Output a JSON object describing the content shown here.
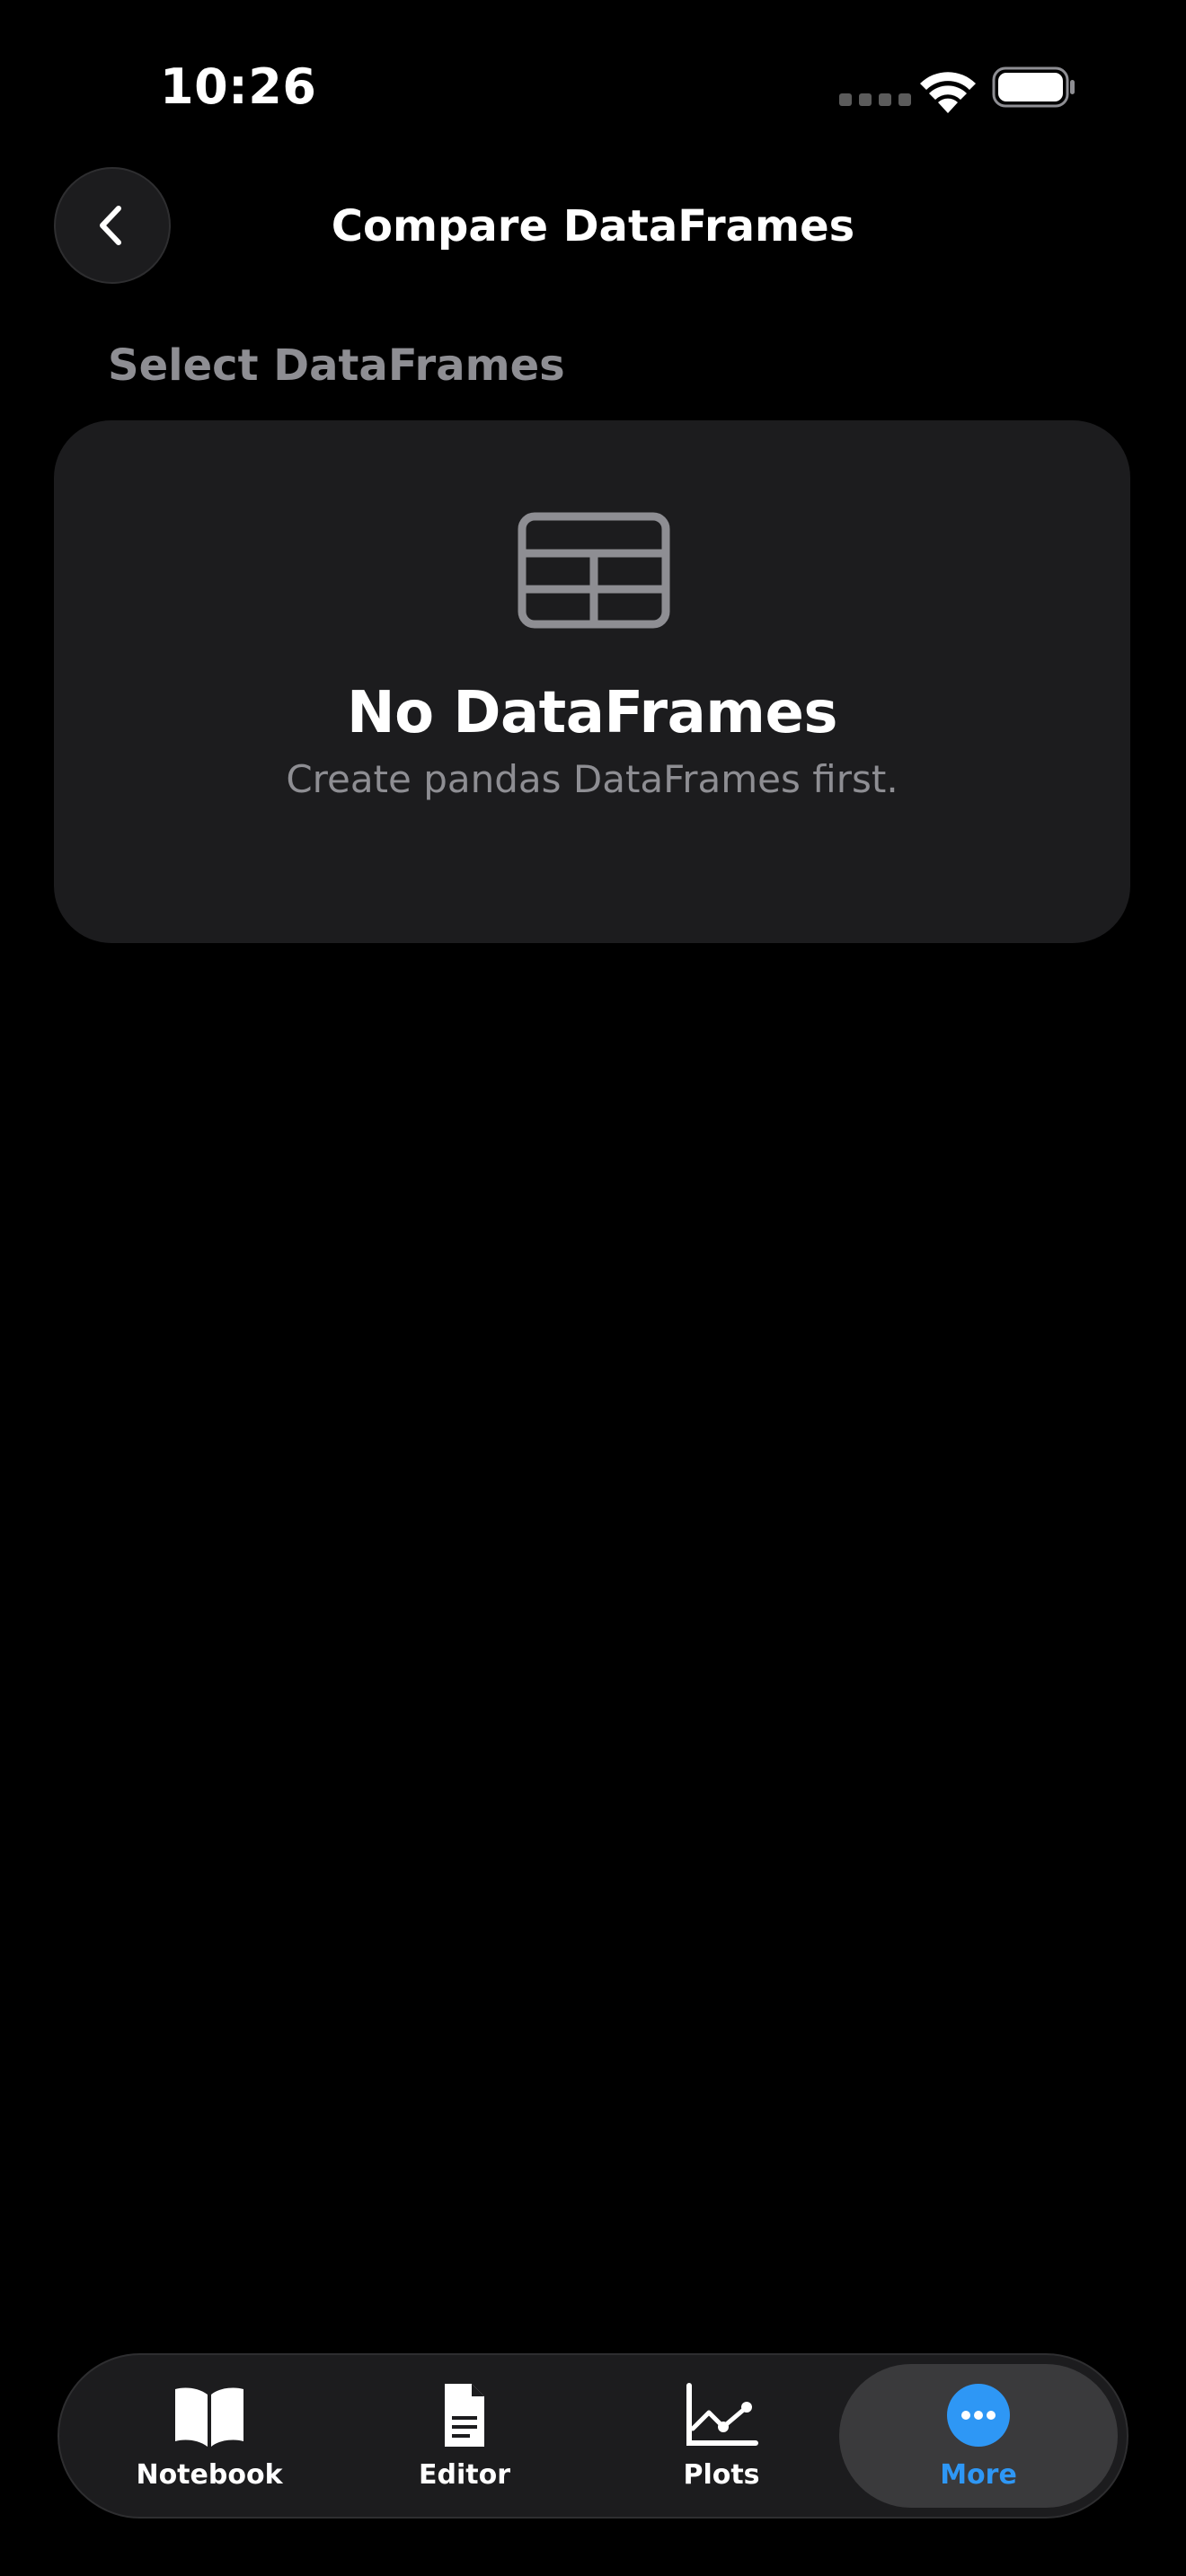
{
  "status_bar": {
    "time": "10:26"
  },
  "nav": {
    "title": "Compare DataFrames"
  },
  "section": {
    "header": "Select DataFrames"
  },
  "empty_state": {
    "title": "No DataFrames",
    "subtitle": "Create pandas DataFrames first.",
    "icon": "table-icon"
  },
  "tab_bar": {
    "tabs": [
      {
        "label": "Notebook",
        "icon": "book-icon",
        "active": false
      },
      {
        "label": "Editor",
        "icon": "document-icon",
        "active": false
      },
      {
        "label": "Plots",
        "icon": "line-chart-icon",
        "active": false
      },
      {
        "label": "More",
        "icon": "more-icon",
        "active": true
      }
    ]
  },
  "colors": {
    "background": "#000000",
    "card": "#1c1c1e",
    "secondary_text": "#8e8e93",
    "accent": "#2e97f5"
  }
}
